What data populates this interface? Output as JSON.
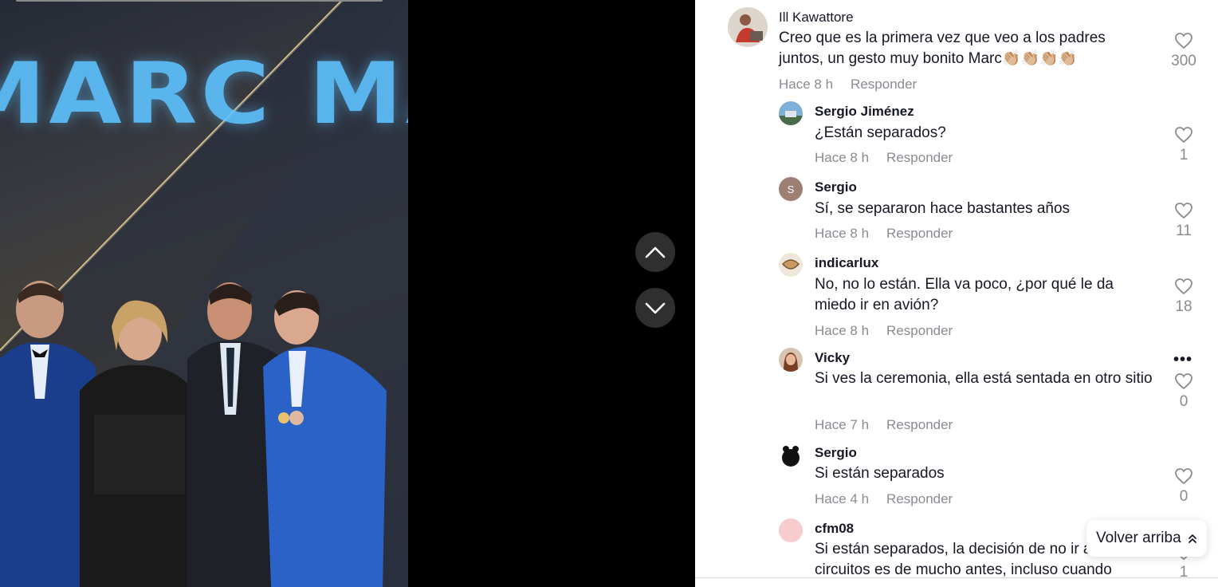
{
  "video": {
    "stage_text": "MARC MA"
  },
  "nav": {
    "up_icon": "chevron-up-icon",
    "down_icon": "chevron-down-icon"
  },
  "comments": [
    {
      "username": "Ill Kawattore",
      "text": "Creo que es la primera vez que veo a los padres juntos, un gesto muy bonito Marc👏🏼👏🏼👏🏼👏🏼",
      "time": "Hace 8 h",
      "reply": "Responder",
      "likes": "300",
      "avatar_color": "#c9b9a8"
    },
    {
      "username": "Sergio Jiménez",
      "text": "¿Están separados?",
      "time": "Hace 8 h",
      "reply": "Responder",
      "likes": "1",
      "avatar_color": "#6fa0c8"
    },
    {
      "username": "Sergio",
      "avatar_letter": "S",
      "text": "Sí, se separaron hace bastantes años",
      "time": "Hace 8 h",
      "reply": "Responder",
      "likes": "11",
      "avatar_color": "#9c7e72"
    },
    {
      "username": "indicarlux",
      "text": "No, no lo están. Ella va poco, ¿por qué le da miedo ir en avión?",
      "time": "Hace 8 h",
      "reply": "Responder",
      "likes": "18",
      "avatar_color": "#c89a62"
    },
    {
      "username": "Vicky",
      "text": "Si ves la ceremonia, ella está sentada en otro sitio",
      "time": "Hace 7 h",
      "reply": "Responder",
      "likes": "0",
      "avatar_color": "#b07a5c"
    },
    {
      "username": "Sergio",
      "text": "Si están separados",
      "time": "Hace 4 h",
      "reply": "Responder",
      "likes": "0",
      "avatar_color": "#111111"
    },
    {
      "username": "cfm08",
      "text": "Si están separados, la decisión de no ir a los circuitos es de mucho antes, incluso cuando",
      "likes": "1",
      "avatar_color": "#f6cccc"
    }
  ],
  "back_to_top": {
    "label": "Volver arriba",
    "icon": "double-chevron-up-icon"
  },
  "more_options": "•••"
}
